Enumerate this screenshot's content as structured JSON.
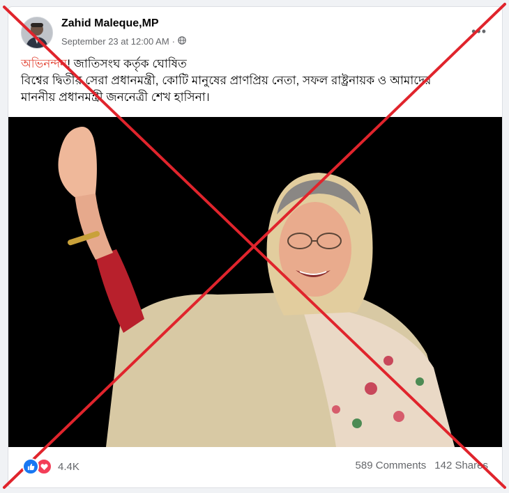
{
  "post": {
    "author": "Zahid Maleque,MP",
    "date": "September 23 at 12:00 AM",
    "audience_icon": "globe-icon",
    "menu_label": "•••",
    "text_highlight": "অভিনন্দন",
    "text_line1_rest": "! জাতিসংঘ কর্তৃক ঘোষিত",
    "text_line2": "বিশ্বের দ্বিতীয় সেরা প্রধানমন্ত্রী, কোটি মানুষের প্রাণপ্রিয় নেতা, সফল রাষ্ট্রনায়ক ও আমাদের",
    "text_line3": "মাননীয় প্রধানমন্ত্রী জননেত্রী শেখ হাসিনা।"
  },
  "footer": {
    "reaction_icons": [
      "like-icon",
      "love-icon"
    ],
    "reaction_count": "4.4K",
    "comments": "589 Comments",
    "shares": "142 Shares"
  },
  "colors": {
    "highlight": "#e34a3a",
    "cross": "#e0242c",
    "like": "#1877f2",
    "love": "#f33e58"
  }
}
